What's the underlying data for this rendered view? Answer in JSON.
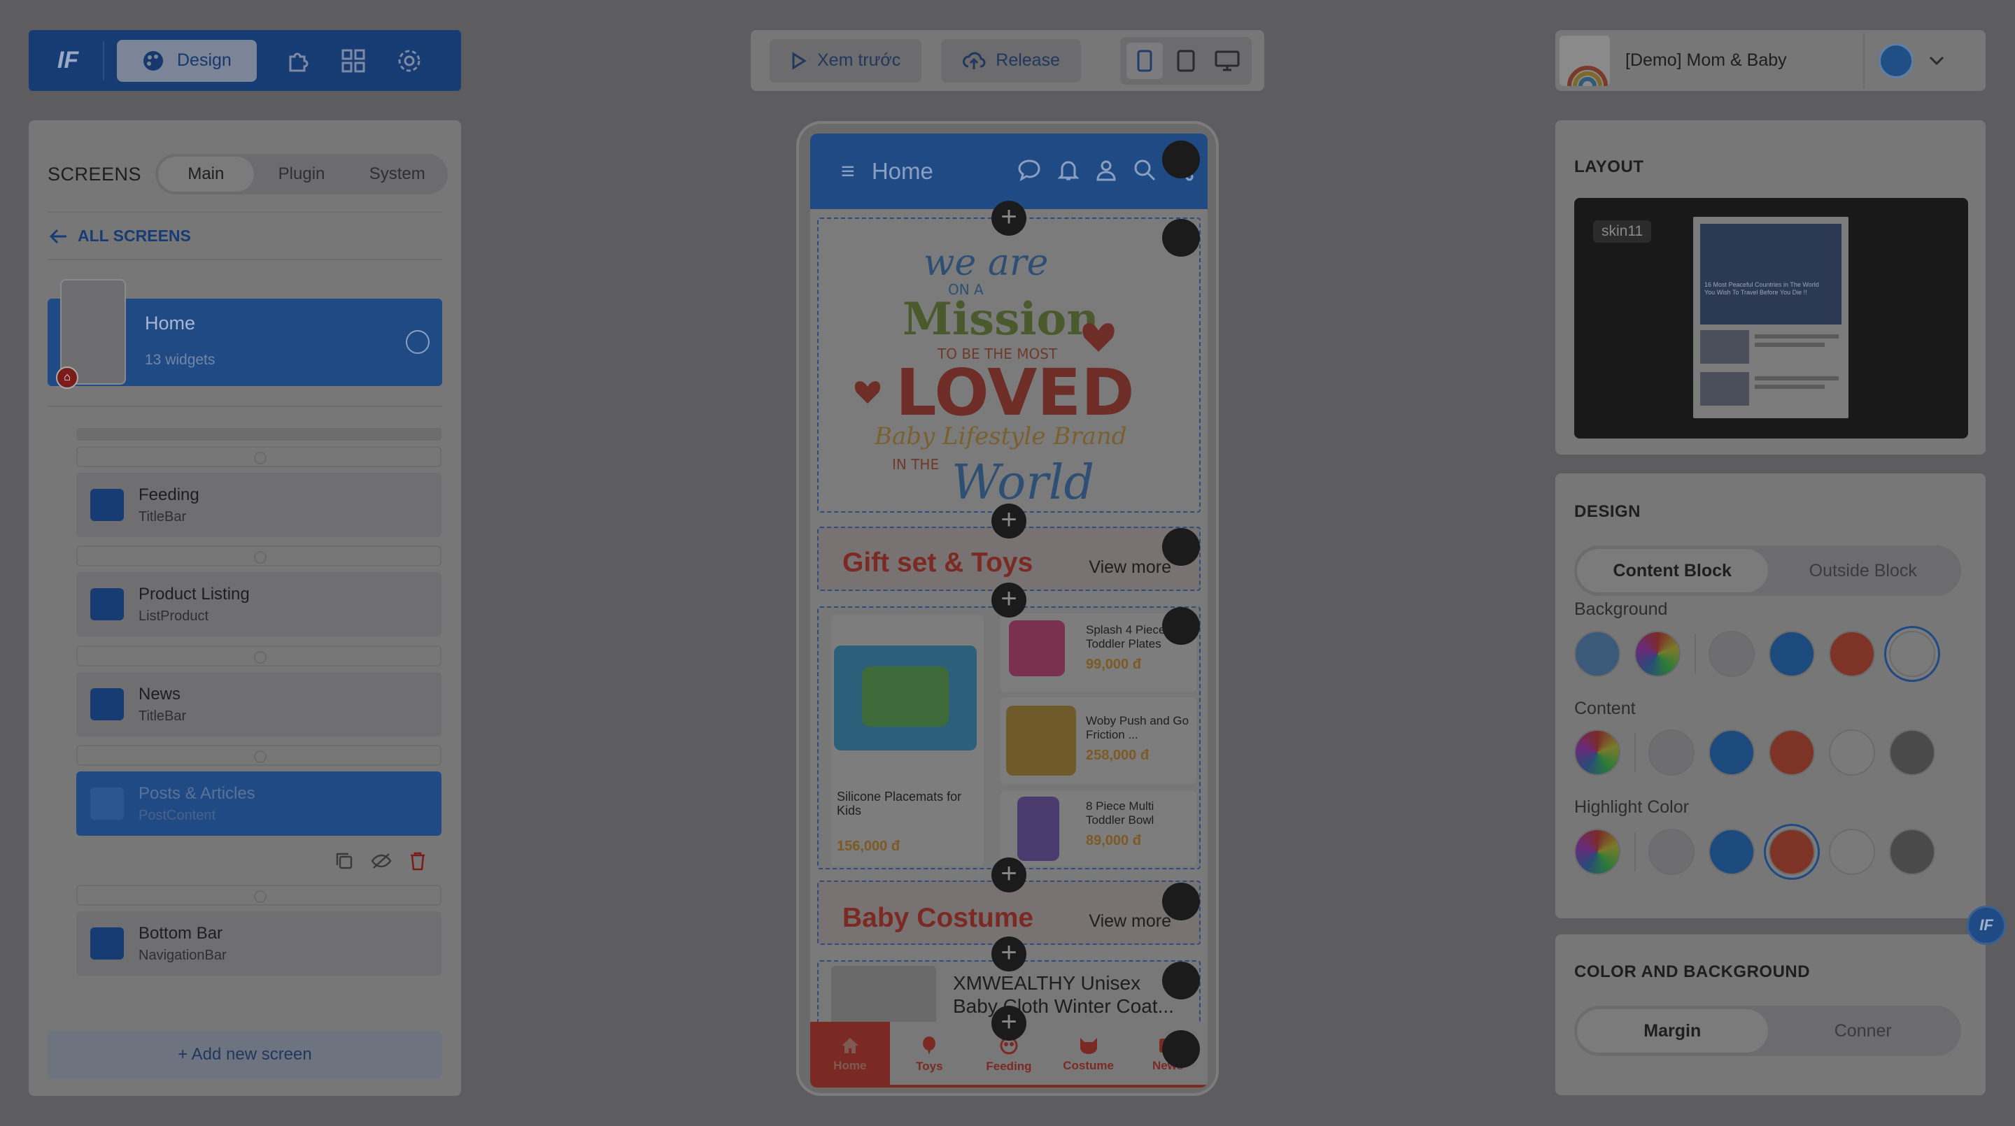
{
  "toolbar_left": {
    "logo_text": "IF",
    "design_label": "Design",
    "icons": [
      "plugin-icon",
      "grid-icon",
      "gear-icon"
    ]
  },
  "toolbar_center": {
    "preview_label": "Xem trước",
    "release_label": "Release",
    "devices": [
      "mobile",
      "tablet",
      "desktop"
    ],
    "active_device": "mobile"
  },
  "toolbar_right": {
    "app_name": "[Demo] Mom & Baby"
  },
  "left_panel": {
    "title": "SCREENS",
    "tabs": [
      "Main",
      "Plugin",
      "System"
    ],
    "active_tab": "Main",
    "all_screens_label": "ALL SCREENS",
    "home_screen": {
      "name": "Home",
      "widget_count": "13 widgets"
    },
    "widgets": [
      {
        "name": "Feeding",
        "type": "TitleBar"
      },
      {
        "name": "Product Listing",
        "type": "ListProduct"
      },
      {
        "name": "News",
        "type": "TitleBar"
      },
      {
        "name": "Posts & Articles",
        "type": "PostContent"
      },
      {
        "name": "Bottom Bar",
        "type": "NavigationBar"
      }
    ],
    "selected_widget": "Posts & Articles",
    "add_screen_label": "+ Add new screen"
  },
  "phone": {
    "appbar_title": "Home",
    "banner": {
      "line1": "we are",
      "line2": "ON A",
      "line3": "Mission",
      "line4": "TO BE THE MOST",
      "line5": "LOVED",
      "line6": "Baby Lifestyle Brand",
      "line7": "IN THE",
      "line8": "World"
    },
    "section1": {
      "title": "Gift set & Toys",
      "view_more": "View more"
    },
    "products": [
      {
        "name": "Silicone Placemats for Kids",
        "price": "156,000 đ"
      },
      {
        "name": "Splash 4 Piece Toddler Plates",
        "price": "99,000 đ"
      },
      {
        "name": "Woby Push and Go Friction ...",
        "price": "258,000 đ"
      },
      {
        "name": "8 Piece Multi Toddler Bowl",
        "price": "89,000 đ"
      }
    ],
    "section2": {
      "title": "Baby Costume",
      "view_more": "View more"
    },
    "costume_item": "XMWEALTHY Unisex Baby Cloth Winter Coat...",
    "bottom_bar": [
      "Home",
      "Toys",
      "Feeding",
      "Costume",
      "News"
    ],
    "bottom_bar_active": "Home"
  },
  "right_panel": {
    "layout_title": "LAYOUT",
    "skin_name": "skin11",
    "skin_preview_texts": [
      "16 Most Peaceful Countries in The World You Wish To Travel Before You Die !!"
    ],
    "design_title": "DESIGN",
    "design_tabs": [
      "Content Block",
      "Outside Block"
    ],
    "design_active_tab": "Content Block",
    "background_label": "Background",
    "content_label": "Content",
    "highlight_label": "Highlight Color",
    "color_section_title": "COLOR AND BACKGROUND",
    "color_tabs": [
      "Margin",
      "Conner"
    ],
    "color_active_tab": "Margin"
  },
  "colors": {
    "brand_blue": "#1f4a84",
    "brand_red": "#7a2a23",
    "background_swatches": [
      "#6e6e70",
      "#1d4a7d",
      "#7d3427",
      "#7a7a7a"
    ],
    "content_swatches": [
      "#6e6e70",
      "#1d4a7d",
      "#7d3427",
      "#7a7a7a",
      "#4a4a4a"
    ],
    "highlight_swatches": [
      "#6e6e70",
      "#1d4a7d",
      "#7d3427",
      "#7a7a7a",
      "#4a4a4a"
    ],
    "background_selected_index": 3,
    "highlight_selected_index": 2
  }
}
